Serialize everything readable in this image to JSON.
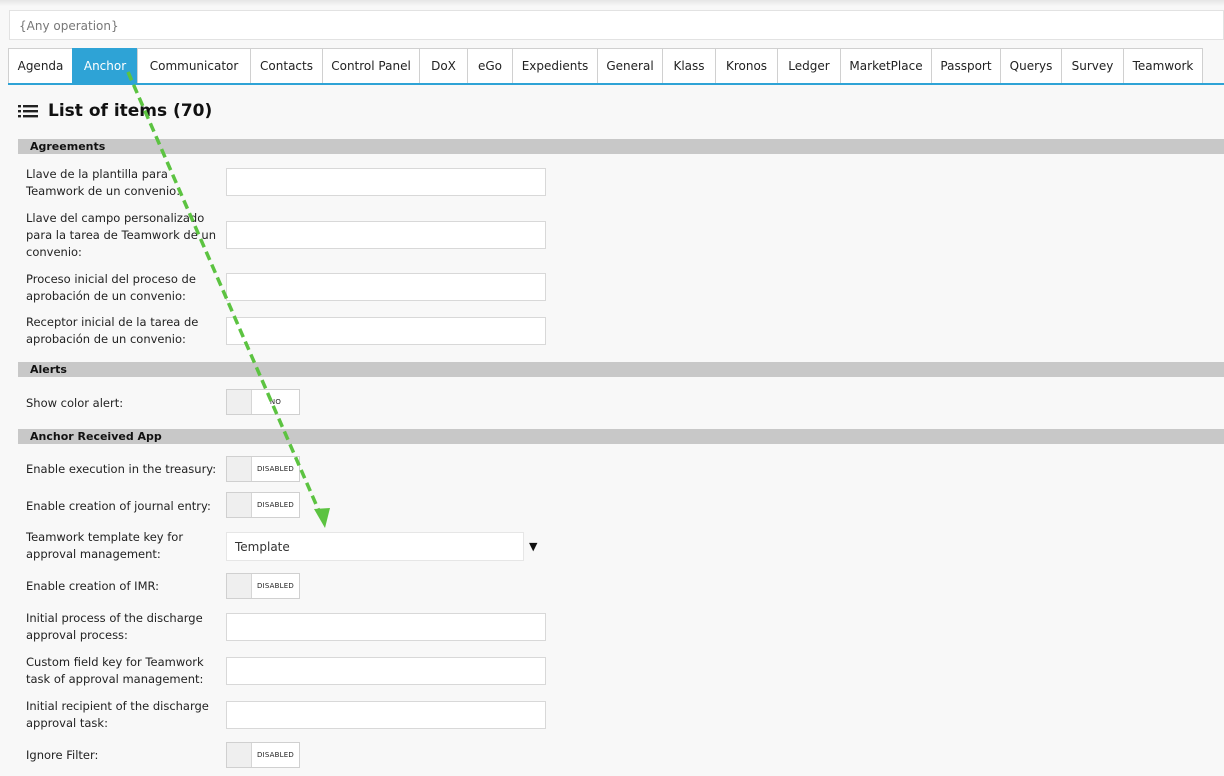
{
  "operation_select": {
    "value": "{Any operation}"
  },
  "tabs": [
    {
      "label": "Agenda",
      "active": false
    },
    {
      "label": "Anchor",
      "active": true
    },
    {
      "label": "Communicator",
      "active": false
    },
    {
      "label": "Contacts",
      "active": false
    },
    {
      "label": "Control Panel",
      "active": false
    },
    {
      "label": "DoX",
      "active": false
    },
    {
      "label": "eGo",
      "active": false
    },
    {
      "label": "Expedients",
      "active": false
    },
    {
      "label": "General",
      "active": false
    },
    {
      "label": "Klass",
      "active": false
    },
    {
      "label": "Kronos",
      "active": false
    },
    {
      "label": "Ledger",
      "active": false
    },
    {
      "label": "MarketPlace",
      "active": false
    },
    {
      "label": "Passport",
      "active": false
    },
    {
      "label": "Querys",
      "active": false
    },
    {
      "label": "Survey",
      "active": false
    },
    {
      "label": "Teamwork",
      "active": false
    }
  ],
  "list_title": "List of items (70)",
  "sections": {
    "agreements": {
      "title": "Agreements",
      "fields": [
        {
          "label": "Llave de la plantilla para Teamwork de un convenio:",
          "value": ""
        },
        {
          "label": "Llave del campo personalizado para la tarea de Teamwork de un convenio:",
          "value": ""
        },
        {
          "label": "Proceso inicial del proceso de aprobación de un convenio:",
          "value": ""
        },
        {
          "label": "Receptor inicial de la tarea de aprobación de un convenio:",
          "value": ""
        }
      ]
    },
    "alerts": {
      "title": "Alerts",
      "fields": [
        {
          "label": "Show color alert:",
          "toggle": "NO"
        }
      ]
    },
    "anchor_received": {
      "title": "Anchor Received App",
      "fields": [
        {
          "label": "Enable execution in the treasury:",
          "toggle": "DISABLED"
        },
        {
          "label": "Enable creation of journal entry:",
          "toggle": "DISABLED"
        },
        {
          "label": "Teamwork template key for approval management:",
          "select": "Template"
        },
        {
          "label": "Enable creation of IMR:",
          "toggle": "DISABLED"
        },
        {
          "label": "Initial process of the discharge approval process:",
          "value": ""
        },
        {
          "label": "Custom field key for Teamwork task of approval management:",
          "value": ""
        },
        {
          "label": "Initial recipient of the discharge approval task:",
          "value": ""
        },
        {
          "label": "Ignore Filter:",
          "toggle": "DISABLED"
        }
      ]
    }
  },
  "colors": {
    "accent": "#2ea3d6",
    "annotation_arrow": "#5cc341",
    "section_header": "#c8c8c8"
  },
  "icons": {
    "list_icon": "list-icon",
    "dropdown_caret": "caret-down-icon"
  }
}
